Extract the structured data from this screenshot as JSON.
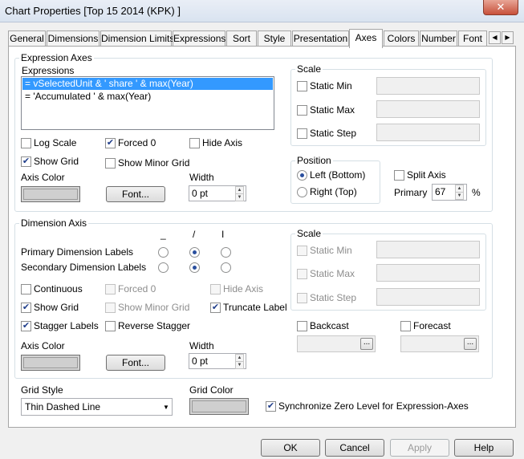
{
  "window": {
    "title": "Chart Properties [Top 15 2014 (KPK) ]",
    "close": "✕"
  },
  "tabs": [
    "General",
    "Dimensions",
    "Dimension Limits",
    "Expressions",
    "Sort",
    "Style",
    "Presentation",
    "Axes",
    "Colors",
    "Number",
    "Font"
  ],
  "active_tab": "Axes",
  "expression_axes": {
    "group_label": "Expression Axes",
    "expressions_label": "Expressions",
    "expressions": [
      "= vSelectedUnit  & ' share ' & max(Year)",
      "= 'Accumulated ' & max(Year)"
    ],
    "log_scale": "Log Scale",
    "forced_0": "Forced 0",
    "hide_axis": "Hide Axis",
    "show_grid": "Show Grid",
    "show_minor_grid": "Show Minor Grid",
    "axis_color": "Axis Color",
    "font_button": "Font...",
    "width_label": "Width",
    "width_value": "0 pt",
    "scale": {
      "label": "Scale",
      "static_min": "Static Min",
      "static_max": "Static Max",
      "static_step": "Static Step"
    },
    "position": {
      "label": "Position",
      "left_bottom": "Left (Bottom)",
      "right_top": "Right (Top)"
    },
    "split_axis": "Split Axis",
    "primary_label": "Primary",
    "primary_value": "67",
    "percent": "%"
  },
  "dimension_axis": {
    "group_label": "Dimension Axis",
    "orientation_headers": [
      "_",
      "/",
      "I"
    ],
    "primary_labels": "Primary Dimension Labels",
    "secondary_labels": "Secondary Dimension Labels",
    "continuous": "Continuous",
    "forced_0": "Forced 0",
    "hide_axis": "Hide Axis",
    "show_grid": "Show Grid",
    "show_minor_grid": "Show Minor Grid",
    "truncate_label": "Truncate Label",
    "stagger_labels": "Stagger Labels",
    "reverse_stagger": "Reverse Stagger",
    "axis_color": "Axis Color",
    "font_button": "Font...",
    "width_label": "Width",
    "width_value": "0 pt",
    "scale": {
      "label": "Scale",
      "static_min": "Static Min",
      "static_max": "Static Max",
      "static_step": "Static Step"
    },
    "backcast": "Backcast",
    "forecast": "Forecast",
    "ellipsis": "..."
  },
  "grid_style": {
    "label": "Grid Style",
    "value": "Thin Dashed Line"
  },
  "grid_color": {
    "label": "Grid Color"
  },
  "sync_zero": "Synchronize Zero Level for Expression-Axes",
  "buttons": {
    "ok": "OK",
    "cancel": "Cancel",
    "apply": "Apply",
    "help": "Help"
  },
  "checkmark": "✔"
}
